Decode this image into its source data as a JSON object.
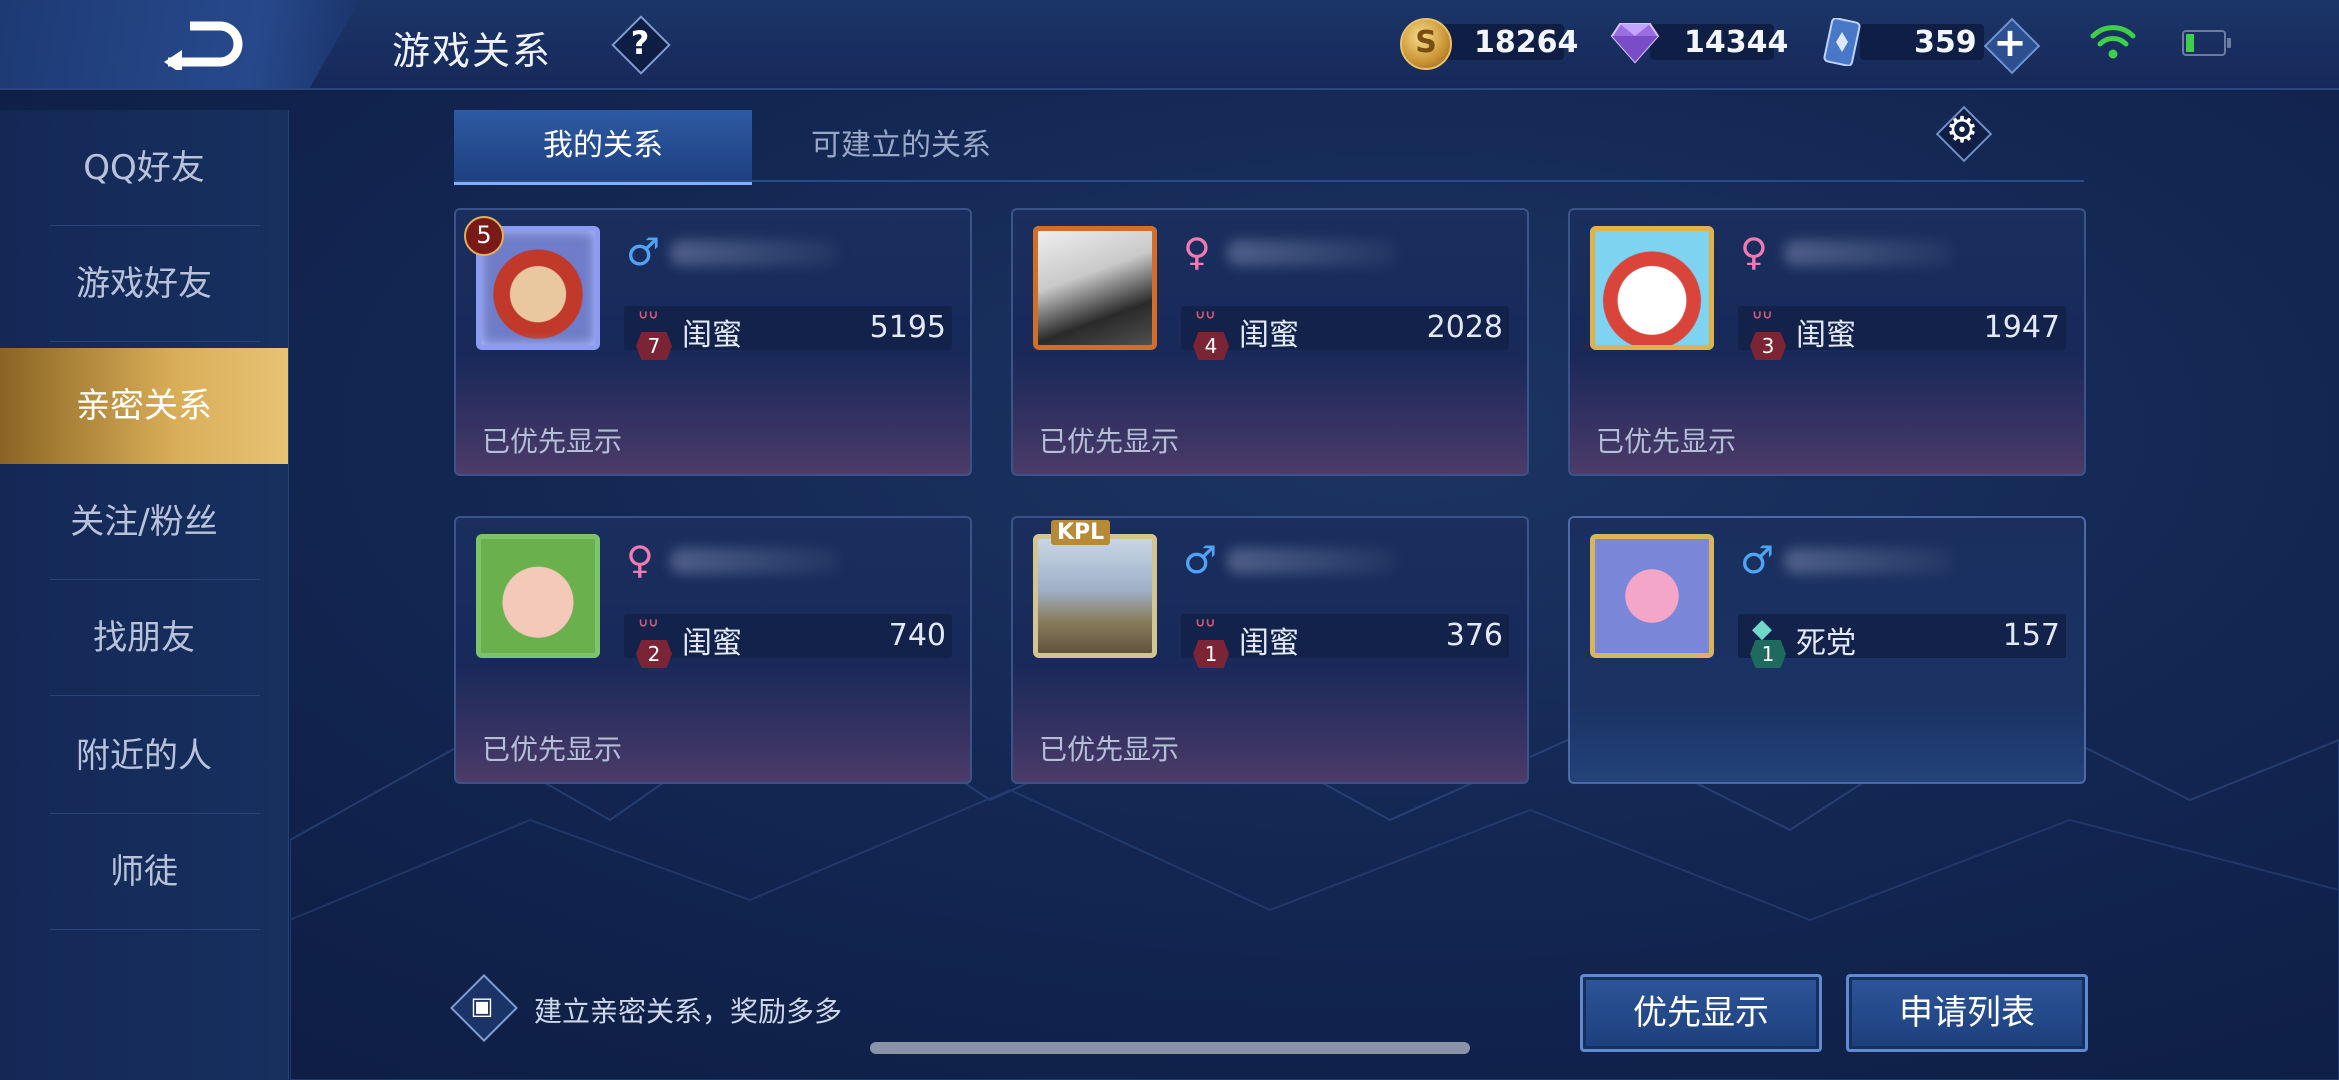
{
  "header": {
    "title": "游戏关系",
    "help_label": "?",
    "currencies": [
      {
        "name": "gold-coin",
        "value": "18264"
      },
      {
        "name": "diamond",
        "value": "14344"
      },
      {
        "name": "coupon",
        "value": "359"
      }
    ],
    "plus_label": "+"
  },
  "sidebar": {
    "items": [
      {
        "label": "QQ好友"
      },
      {
        "label": "游戏好友"
      },
      {
        "label": "亲密关系",
        "active": true
      },
      {
        "label": "关注/粉丝"
      },
      {
        "label": "找朋友"
      },
      {
        "label": "附近的人"
      },
      {
        "label": "师徒"
      }
    ]
  },
  "tabs": [
    {
      "label": "我的关系",
      "active": true
    },
    {
      "label": "可建立的关系"
    }
  ],
  "cards": [
    {
      "gender": "♂",
      "gender_type": "male",
      "relation": "闺蜜",
      "relation_level": "7",
      "intimacy": "5195",
      "status": "已优先显示",
      "avatar_level": "5"
    },
    {
      "gender": "♀",
      "gender_type": "female",
      "relation": "闺蜜",
      "relation_level": "4",
      "intimacy": "2028",
      "status": "已优先显示"
    },
    {
      "gender": "♀",
      "gender_type": "female",
      "relation": "闺蜜",
      "relation_level": "3",
      "intimacy": "1947",
      "status": "已优先显示"
    },
    {
      "gender": "♀",
      "gender_type": "female",
      "relation": "闺蜜",
      "relation_level": "2",
      "intimacy": "740",
      "status": "已优先显示"
    },
    {
      "gender": "♂",
      "gender_type": "male",
      "relation": "闺蜜",
      "relation_level": "1",
      "intimacy": "376",
      "status": "已优先显示",
      "avatar_tag": "KPL"
    },
    {
      "gender": "♂",
      "gender_type": "male",
      "relation": "死党",
      "relation_level": "1",
      "intimacy": "157",
      "status": ""
    }
  ],
  "footer": {
    "tip": "建立亲密关系，奖励多多",
    "priority_button": "优先显示",
    "request_list_button": "申请列表"
  },
  "colors": {
    "accent_gold": "#d9ad57",
    "male": "#4fa4f5",
    "female": "#f07bb2",
    "background": "#132753"
  }
}
